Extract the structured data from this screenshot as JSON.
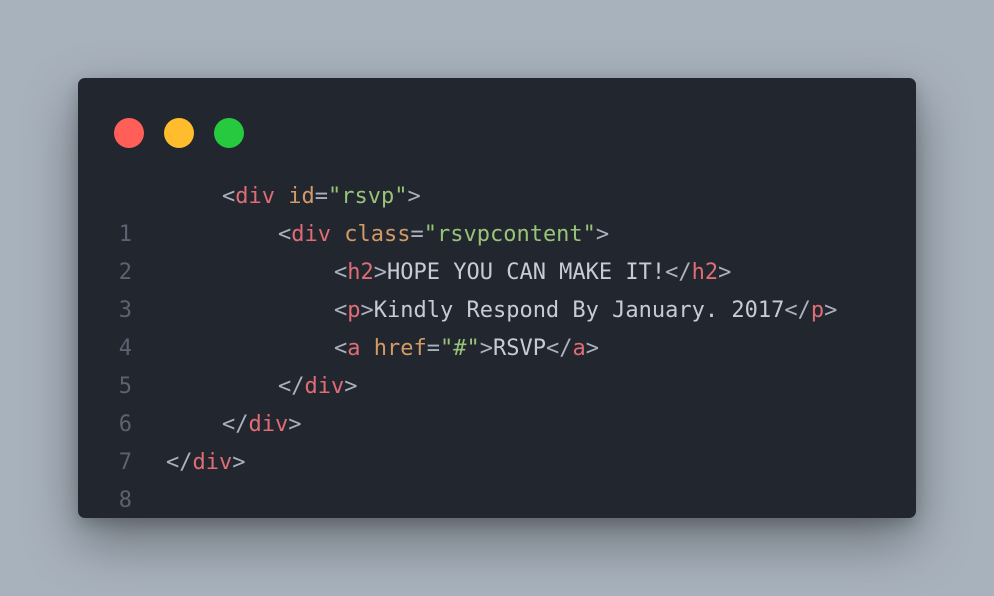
{
  "window": {
    "buttons": [
      {
        "name": "close",
        "color": "#ff5f56"
      },
      {
        "name": "minimize",
        "color": "#ffbd2e"
      },
      {
        "name": "maximize",
        "color": "#27c93f"
      }
    ]
  },
  "code": {
    "lines": [
      {
        "number": "1",
        "tag_open": "<",
        "tag": "div",
        "attr": "id",
        "eq": "=",
        "value": "\"rsvp\"",
        "tag_close": ">"
      },
      {
        "number": "2",
        "tag_open": "<",
        "tag": "div",
        "attr": "class",
        "eq": "=",
        "value": "\"rsvpcontent\"",
        "tag_close": ">"
      },
      {
        "number": "3",
        "tag_open": "<",
        "tag": "h2",
        "tag_close": ">",
        "text": "HOPE YOU CAN MAKE IT!",
        "end_open": "</",
        "end_tag": "h2",
        "end_close": ">"
      },
      {
        "number": "4",
        "tag_open": "<",
        "tag": "p",
        "tag_close": ">",
        "text": "Kindly Respond By January. 2017",
        "end_open": "</",
        "end_tag": "p",
        "end_close": ">"
      },
      {
        "number": "5",
        "tag_open": "<",
        "tag": "a",
        "attr": "href",
        "eq": "=",
        "value": "\"#\"",
        "tag_close": ">",
        "text": "RSVP",
        "end_open": "</",
        "end_tag": "a",
        "end_close": ">"
      },
      {
        "number": "6",
        "end_open": "</",
        "end_tag": "div",
        "end_close": ">"
      },
      {
        "number": "7",
        "end_open": "</",
        "end_tag": "div",
        "end_close": ">"
      },
      {
        "number": "8",
        "end_open": "</",
        "end_tag": "div",
        "end_close": ">"
      }
    ]
  }
}
